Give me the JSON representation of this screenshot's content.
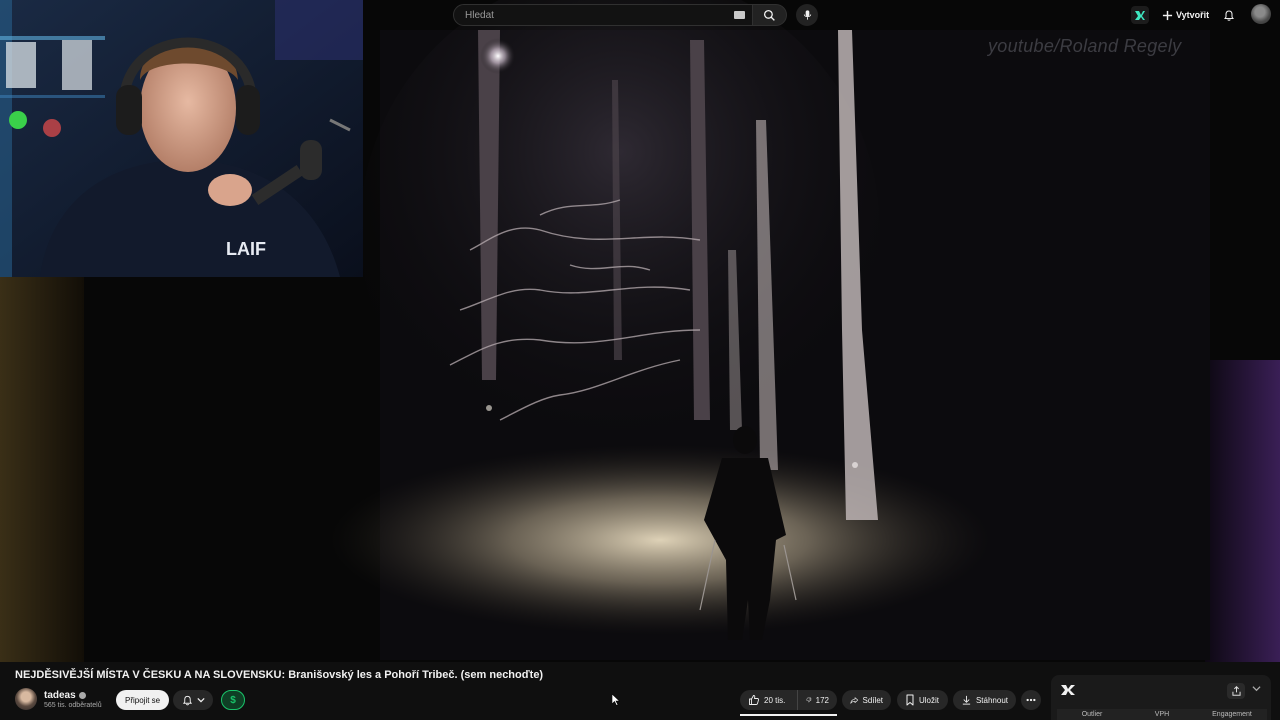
{
  "masthead": {
    "search_placeholder": "Hledat",
    "create_label": "Vytvořit"
  },
  "video": {
    "watermark": "youtube/Roland Regely",
    "title": "NEJDĚSIVĚJŠÍ MÍSTA V ČESKU A NA SLOVENSKU: Branišovský les a Pohoří Tribeč. (sem nechoďte)"
  },
  "channel": {
    "name": "tadeas",
    "subscribers": "565 tis. odběratelů",
    "join_label": "Připojit se",
    "thanks_symbol": "$"
  },
  "actions": {
    "likes": "20 tis.",
    "dislikes": "172",
    "share_label": "Sdílet",
    "save_label": "Uložit",
    "download_label": "Stáhnout"
  },
  "panel": {
    "columns": [
      "Outlier",
      "VPH",
      "Engagement"
    ]
  },
  "icons": {
    "search": "search-icon",
    "mic": "mic-icon",
    "create": "plus-icon",
    "bell": "bell-icon",
    "like": "thumbs-up-icon",
    "dislike": "thumbs-down-icon",
    "share": "share-icon",
    "save": "bookmark-icon",
    "download": "download-icon",
    "more": "more-horizontal-icon"
  },
  "colors": {
    "background": "#0f0f0f",
    "pill": "#272727",
    "thanks_green": "#19c46a"
  }
}
